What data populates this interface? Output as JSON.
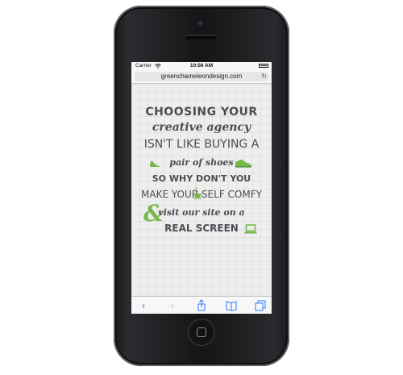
{
  "device": {
    "name": "iPhone"
  },
  "status_bar": {
    "carrier": "Carrier",
    "time": "10:56 AM"
  },
  "browser": {
    "url": "greenchameleondesign.com"
  },
  "content": {
    "line1": "CHOOSING YOUR",
    "line2": "creative agency",
    "line3": "ISN'T LIKE BUYING A",
    "line4": "pair of shoes",
    "line5": "SO WHY DON'T YOU",
    "line6": "MAKE YOUR SELF COMFY",
    "line7": "visit our site on a",
    "line8": "REAL SCREEN",
    "ampersand": "&"
  },
  "colors": {
    "accent_green": "#77b84a",
    "text_gray": "#4b4d53",
    "ios_blue": "#2a7ef5"
  },
  "icons": [
    "wifi-icon",
    "reload-icon",
    "high-heel-icon",
    "sneaker-icon",
    "coffee-cup-icon",
    "laptop-icon",
    "back-icon",
    "forward-icon",
    "share-icon",
    "bookmarks-icon",
    "tabs-icon"
  ]
}
